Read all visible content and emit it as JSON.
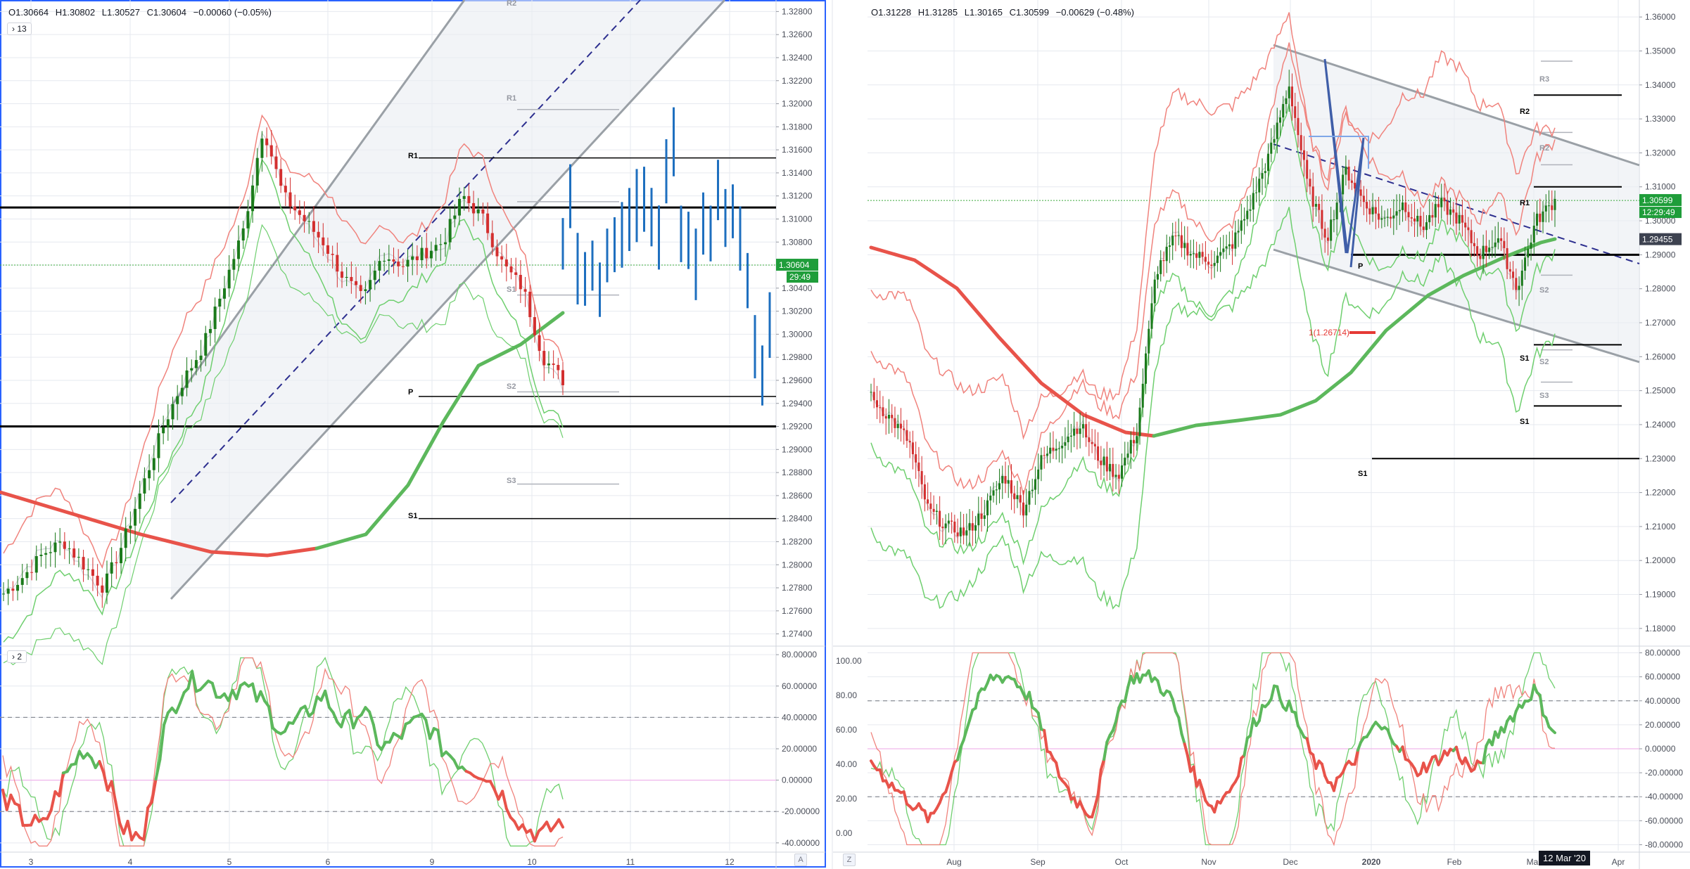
{
  "colors": {
    "up": "#26a69a",
    "upBar": "#2e8b2e",
    "down": "#e53935",
    "hlc": "#1e6fbf",
    "upperEnv": "#f0837d",
    "lowerEnv": "#6fcf6f",
    "ma": "#e8534a",
    "maGreen": "#5cb85c",
    "channel": "#9aa0a6",
    "pivot": "#000000",
    "grid": "#e6e9ef",
    "text": "#131722",
    "axisText": "#4a4e59",
    "priceTagGreen": "#1f9d3a",
    "priceTagDark": "#3d4250"
  },
  "left": {
    "legend": {
      "o": "O1.30664",
      "h": "H1.30802",
      "l": "L1.30527",
      "c": "C1.30604",
      "chg": "−0.00060 (−0.05%)"
    },
    "interval_badge": "13",
    "osc_badge": "2",
    "price_tag": "1.30604",
    "countdown": "29:49",
    "pivot_labels": [
      "R2",
      "R1",
      "R1",
      "S1",
      "S2",
      "S3",
      "P",
      "S1"
    ],
    "axis_corner": "A",
    "x_labels": [
      "3",
      "4",
      "5",
      "6",
      "9",
      "10",
      "11",
      "12"
    ]
  },
  "right": {
    "legend": {
      "o": "O1.31228",
      "h": "H1.31285",
      "l": "L1.30165",
      "c": "C1.30599",
      "chg": "−0.00629 (−0.48%)"
    },
    "price_tag": "1.30599",
    "countdown": "12:29:49",
    "level_tag": "1.29455",
    "fib_label": "1(1.26714)",
    "pivot_labels": [
      "R3",
      "R2",
      "R2",
      "R1",
      "P",
      "S1",
      "S2",
      "S3",
      "S1",
      "S2",
      "S1"
    ],
    "axis_corner": "A",
    "z_corner": "Z",
    "date_box": "12 Mar '20",
    "x_labels": [
      "Aug",
      "Sep",
      "Oct",
      "Nov",
      "Dec",
      "2020",
      "Feb",
      "Mar",
      "Apr"
    ]
  },
  "chart_data": [
    {
      "type": "line",
      "title": "",
      "panel": "left price (intraday bars)",
      "x": [
        "3",
        "4",
        "5",
        "6",
        "9",
        "10",
        "11",
        "12"
      ],
      "y_ticks": [
        "1.32800",
        "1.32600",
        "1.32400",
        "1.32200",
        "1.32000",
        "1.31800",
        "1.31600",
        "1.31400",
        "1.31200",
        "1.31000",
        "1.30800",
        "1.30600",
        "1.30400",
        "1.30200",
        "1.30000",
        "1.29800",
        "1.29600",
        "1.29400",
        "1.29200",
        "1.29000",
        "1.28800",
        "1.28600",
        "1.28400",
        "1.28200",
        "1.28000",
        "1.27800",
        "1.27600",
        "1.27400"
      ],
      "ylim": [
        1.273,
        1.329
      ],
      "series": [
        {
          "values": [
            1.2775,
            1.279,
            1.281,
            1.282,
            1.28,
            1.278,
            1.282,
            1.287,
            1.292,
            1.296,
            1.299,
            1.304,
            1.309,
            1.318,
            1.312,
            1.31,
            1.308,
            1.305,
            1.303,
            1.307,
            1.306,
            1.307,
            1.308,
            1.312,
            1.31,
            1.306,
            1.304,
            1.298,
            1.296
          ]
        }
      ],
      "levels": [
        1.311,
        1.292,
        1.306,
        1.2946,
        1.3153,
        1.284
      ]
    },
    {
      "type": "line",
      "panel": "left oscillator",
      "y_ticks": [
        "80.00000",
        "60.00000",
        "40.00000",
        "20.00000",
        "0.00000",
        "-20.00000",
        "-40.00000"
      ],
      "ylim": [
        -45,
        85
      ],
      "dashed_levels": [
        40,
        -20
      ],
      "series": [
        {
          "values": [
            -10,
            -25,
            -30,
            0,
            20,
            10,
            -30,
            -40,
            30,
            60,
            65,
            55,
            60,
            50,
            30,
            40,
            55,
            35,
            45,
            20,
            30,
            40,
            20,
            10,
            5,
            -10,
            -30,
            -35,
            -25
          ]
        }
      ]
    },
    {
      "type": "line",
      "panel": "right price (daily bars)",
      "x": [
        "Aug",
        "Sep",
        "Oct",
        "Nov",
        "Dec",
        "2020",
        "Feb",
        "Mar",
        "Apr"
      ],
      "y_ticks": [
        "1.36000",
        "1.35000",
        "1.34000",
        "1.33000",
        "1.32000",
        "1.31000",
        "1.30000",
        "1.29000",
        "1.28000",
        "1.27000",
        "1.26000",
        "1.25000",
        "1.24000",
        "1.23000",
        "1.22000",
        "1.21000",
        "1.20000",
        "1.19000",
        "1.18000"
      ],
      "ylim": [
        1.175,
        1.365
      ],
      "series": [
        {
          "values": [
            1.248,
            1.242,
            1.235,
            1.215,
            1.21,
            1.208,
            1.215,
            1.225,
            1.215,
            1.23,
            1.235,
            1.24,
            1.23,
            1.225,
            1.238,
            1.285,
            1.295,
            1.29,
            1.288,
            1.293,
            1.305,
            1.32,
            1.34,
            1.31,
            1.295,
            1.315,
            1.305,
            1.3,
            1.305,
            1.298,
            1.305,
            1.3,
            1.29,
            1.295,
            1.28,
            1.3,
            1.306
          ]
        }
      ],
      "levels": [
        1.2995,
        1.29,
        1.31,
        1.337,
        1.2635,
        1.2455,
        1.23,
        1.2945,
        1.2671
      ]
    },
    {
      "type": "line",
      "panel": "right oscillator",
      "y_ticks_left": [
        "100.00",
        "80.00",
        "60.00",
        "40.00",
        "20.00",
        "0.00"
      ],
      "y_ticks_right": [
        "80.00000",
        "60.00000",
        "40.00000",
        "20.00000",
        "0.00000",
        "-20.00000",
        "-40.00000",
        "-60.00000",
        "-80.00000"
      ],
      "ylim": [
        -85,
        85
      ],
      "dashed_levels": [
        40,
        -40
      ],
      "series": [
        {
          "values": [
            -10,
            -30,
            -45,
            -60,
            -20,
            30,
            60,
            60,
            40,
            -10,
            -40,
            -55,
            20,
            60,
            60,
            40,
            -20,
            -50,
            -30,
            20,
            50,
            30,
            -10,
            -30,
            -10,
            20,
            10,
            -20,
            -10,
            0,
            -20,
            10,
            30,
            50,
            10
          ]
        }
      ]
    }
  ]
}
